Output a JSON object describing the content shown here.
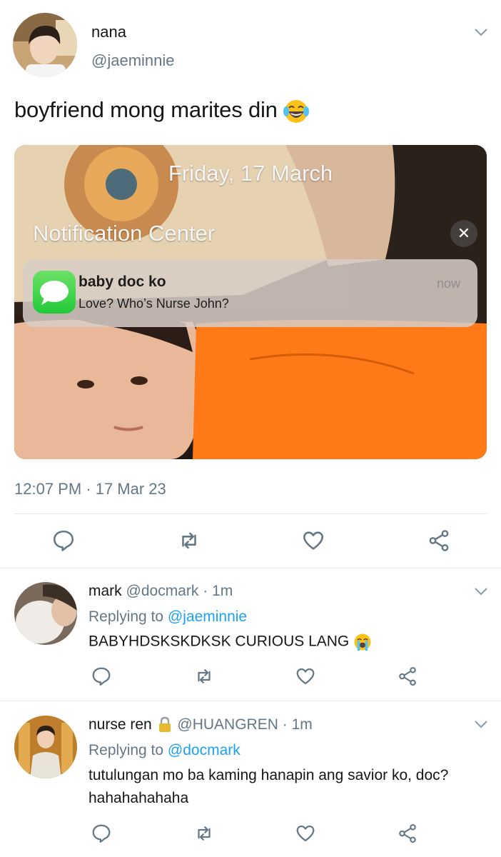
{
  "tweet": {
    "name": "nana",
    "handle": "@jaeminnie",
    "text": "boyfriend mong marites din",
    "emoji": "face-with-tears-of-joy",
    "timestamp": "12:07 PM · 17 Mar 23",
    "media": {
      "date": "Friday, 17 March",
      "center_title": "Notification Center",
      "notification": {
        "sender": "baby doc ko",
        "message": "Love? Who’s Nurse John?",
        "time": "now"
      }
    }
  },
  "replies": [
    {
      "name": "mark",
      "handle": "@docmark",
      "time": "· 1m",
      "replying_label": "Replying to",
      "replying_to": "@jaeminnie",
      "text": "BABYHDSKSKDKSK CURIOUS LANG",
      "emoji": "loudly-crying-face"
    },
    {
      "name": "nurse ren",
      "locked": true,
      "handle": "@HUANGREN",
      "time": "· 1m",
      "replying_label": "Replying to",
      "replying_to": "@docmark",
      "text_line1": "tutulungan mo ba kaming hanapin ang savior ko, doc?",
      "text_line2": "hahahahahaha"
    }
  ],
  "colors": {
    "link": "#1da1f2",
    "muted": "#657786",
    "icon": "#657786",
    "divider": "#e1e8ed"
  }
}
